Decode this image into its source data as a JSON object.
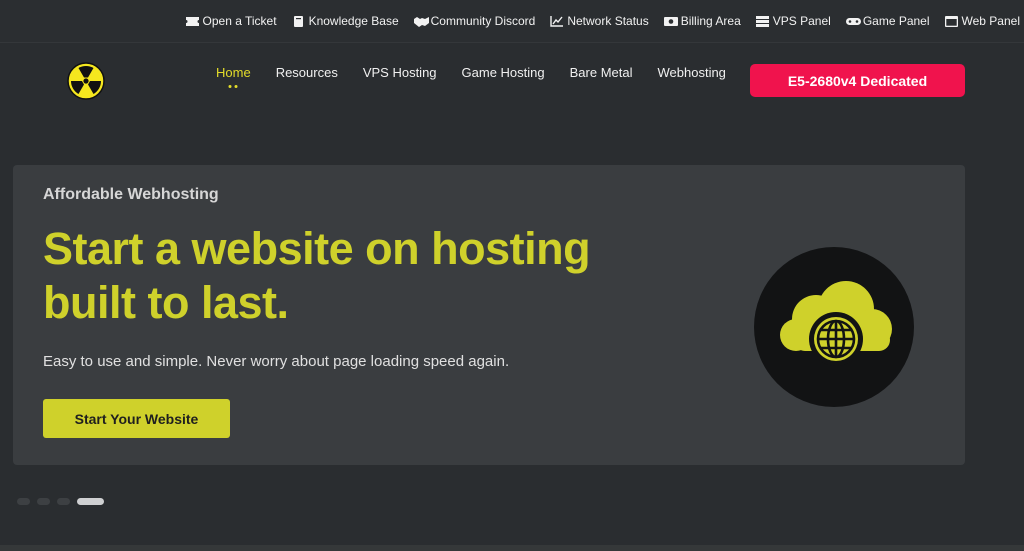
{
  "topbar": {
    "links": [
      {
        "label": "Open a Ticket",
        "icon": "ticket-icon"
      },
      {
        "label": "Knowledge Base",
        "icon": "book-icon"
      },
      {
        "label": "Community Discord",
        "icon": "handshake-icon"
      },
      {
        "label": "Network Status",
        "icon": "chart-icon"
      },
      {
        "label": "Billing Area",
        "icon": "money-icon"
      },
      {
        "label": "VPS Panel",
        "icon": "server-icon"
      },
      {
        "label": "Game Panel",
        "icon": "gamepad-icon"
      },
      {
        "label": "Web Panel",
        "icon": "browser-icon"
      }
    ]
  },
  "nav": {
    "logo": "radiation-logo",
    "links": [
      "Home",
      "Resources",
      "VPS Hosting",
      "Game Hosting",
      "Bare Metal",
      "Webhosting"
    ],
    "active": "Home",
    "cta_label": "E5-2680v4 Dedicated"
  },
  "hero": {
    "eyebrow": "Affordable Webhosting",
    "headline_line1": "Start a website on hosting",
    "headline_line2": "built to last.",
    "subtext": "Easy to use and simple. Never worry about page loading speed again.",
    "button_label": "Start Your Website",
    "art_icon": "cloud-globe-icon"
  },
  "slider": {
    "count": 4,
    "active_index": 3
  },
  "colors": {
    "background": "#2a2d30",
    "card": "#3a3d40",
    "accent": "#cfd12b",
    "active_nav": "#e3dc2a",
    "cta": "#f0134d"
  }
}
